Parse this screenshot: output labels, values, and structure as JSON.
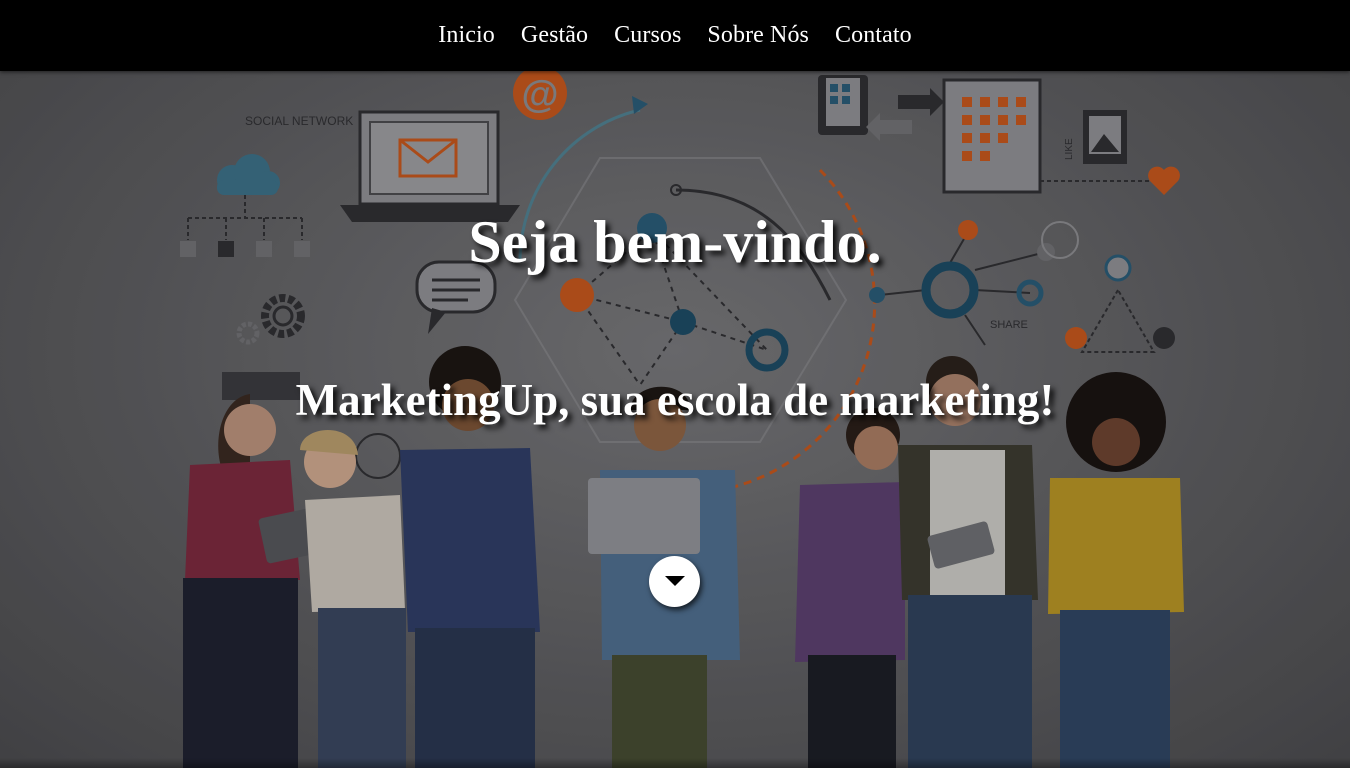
{
  "nav": {
    "items": [
      {
        "label": "Inicio"
      },
      {
        "label": "Gestão"
      },
      {
        "label": "Cursos"
      },
      {
        "label": "Sobre Nós"
      },
      {
        "label": "Contato"
      }
    ]
  },
  "hero": {
    "title": "Seja bem-vindo.",
    "subtitle": "MarketingUp, sua escola de marketing!",
    "background_labels": {
      "social_network": "SOCIAL NETWORK",
      "share": "SHARE",
      "like": "LIKE",
      "at_sign": "@"
    },
    "scroll_button_icon": "caret-down-icon"
  },
  "colors": {
    "navbar_bg": "#000000",
    "nav_text": "#ffffff",
    "hero_text": "#ffffff",
    "accent_orange": "#c2561d",
    "accent_teal": "#2a5b76"
  }
}
